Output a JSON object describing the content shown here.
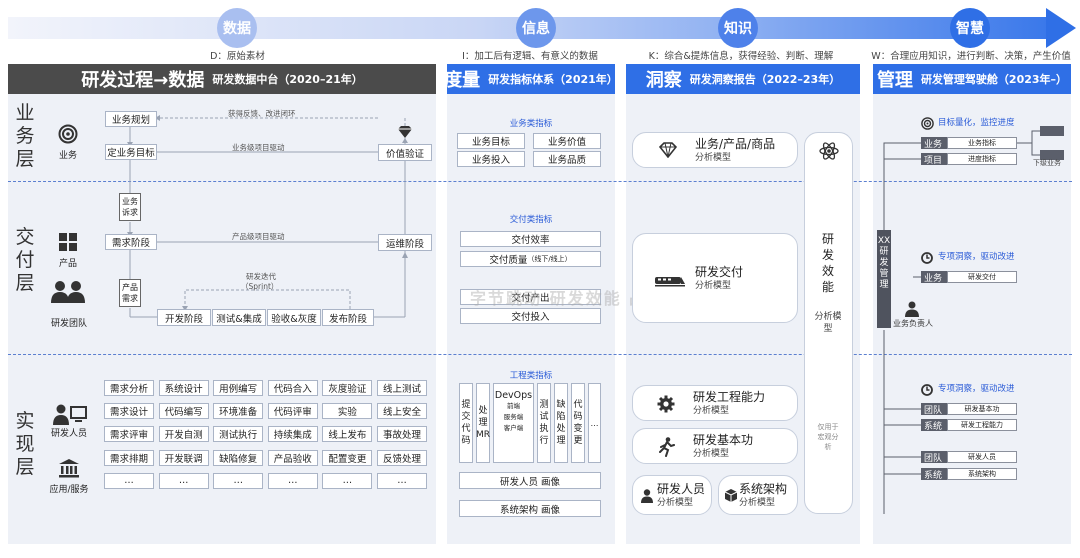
{
  "stages": [
    {
      "label": "数据",
      "desc": "D：原始素材",
      "color": "#a9bff0"
    },
    {
      "label": "信息",
      "desc": "I：加工后有逻辑、有意义的数据",
      "color": "#6d97ec"
    },
    {
      "label": "知识",
      "desc": "K：综合&提炼信息，获得经验、判断、理解",
      "color": "#4e81ea"
    },
    {
      "label": "智慧",
      "desc": "W：合理应用知识，进行判断、决策，产生价值",
      "color": "#2f6fe6"
    }
  ],
  "columns": {
    "data": {
      "title": "研发过程→数据",
      "subtitle": "研发数据中台（2020–21年）",
      "header_color": "#4b4b4b"
    },
    "metrics": {
      "title": "度量",
      "subtitle": "研发指标体系（2021年）",
      "header_color": "#2f6fe6"
    },
    "insight": {
      "title": "洞察",
      "subtitle": "研发洞察报告（2022–23年）",
      "header_color": "#2f6fe6"
    },
    "management": {
      "title": "管理",
      "subtitle": "研发管理驾驶舱（2023年–）",
      "header_color": "#2f6fe6"
    }
  },
  "layers": {
    "business": "业务层",
    "delivery": "交付层",
    "implementation": "实现层"
  },
  "side_labels": {
    "business": "业务",
    "product": "产品",
    "team": "研发团队",
    "developer": "研发人员",
    "app": "应用/服务"
  },
  "process": {
    "biz_plan": "业务规划",
    "biz_goal": "定业务目标",
    "value_verify": "价值验证",
    "biz_appeal": "业务诉求",
    "req_stage": "需求阶段",
    "ops_stage": "运维阶段",
    "prod_req": "产品需求",
    "dev_stage": "开发阶段",
    "test_integ": "测试&集成",
    "accept_gray": "验收&灰度",
    "release_stage": "发布阶段",
    "note_feedback": "获得反馈、改进闭环",
    "note_biz_drive": "业务级项目驱动",
    "note_prod_drive": "产品级项目驱动",
    "note_iter": "研发迭代",
    "note_sprint": "（Sprint）"
  },
  "impl_grid": [
    [
      "需求分析",
      "系统设计",
      "用例编写",
      "代码合入",
      "灰度验证",
      "线上测试"
    ],
    [
      "需求设计",
      "代码编写",
      "环境准备",
      "代码评审",
      "实验",
      "线上安全"
    ],
    [
      "需求评审",
      "开发自测",
      "测试执行",
      "持续集成",
      "线上发布",
      "事故处理"
    ],
    [
      "需求排期",
      "开发联调",
      "缺陷修复",
      "产品验收",
      "配置变更",
      "反馈处理"
    ],
    [
      "…",
      "…",
      "…",
      "…",
      "…",
      "…"
    ]
  ],
  "metrics": {
    "biz_title": "业务类指标",
    "biz_items": [
      "业务目标",
      "业务价值",
      "业务投入",
      "业务品质"
    ],
    "delivery_title": "交付类指标",
    "delivery_efficiency": "交付效率",
    "delivery_quality": "交付质量",
    "delivery_quality_note": "（线下/线上）",
    "delivery_output": "交付产出",
    "delivery_input": "交付投入",
    "eng_title": "工程类指标",
    "eng_v1": "提交代码",
    "eng_v2": "处理MR",
    "devops_title": "DevOps",
    "devops_lines": [
      "前端",
      "服务端",
      "客户端"
    ],
    "eng_v3": "测试执行",
    "eng_v4": "缺陷处理",
    "eng_v5": "代码变更",
    "eng_more": "…",
    "person_profile": "研发人员 画像",
    "arch_profile": "系统架构 画像"
  },
  "insight": {
    "biz_model": "业务/产品/商品",
    "delivery_model": "研发交付",
    "eng_capability": "研发工程能力",
    "basic_skill": "研发基本功",
    "dev_person": "研发人员",
    "sys_arch": "系统架构",
    "model_suffix": "分析模型",
    "efficiency_title": "研发效能",
    "efficiency_model": "分析模型",
    "macro_note": "仅用于宏观分析"
  },
  "management": {
    "goal_title": "目标量化，监控进度",
    "biz_label": "业务",
    "biz_value": "业务指标",
    "proj_label": "项目",
    "proj_value": "进度指标",
    "sub_biz": "下级业务",
    "cockpit_title": "XX研发管理",
    "insight_title_1": "专项洞察，驱动改进",
    "biz_delivery_label": "业务",
    "biz_delivery_value": "研发交付",
    "biz_owner": "业务负责人",
    "insight_title_2": "专项洞察，驱动改进",
    "team_label_1": "团队",
    "team_value_1": "研发基本功",
    "sys_label_1": "系统",
    "sys_value_1": "研发工程能力",
    "team_label_2": "团队",
    "team_value_2": "研发人员",
    "sys_label_2": "系统",
    "sys_value_2": "系统架构"
  },
  "watermark": "字节跳动 研发效能 战略"
}
